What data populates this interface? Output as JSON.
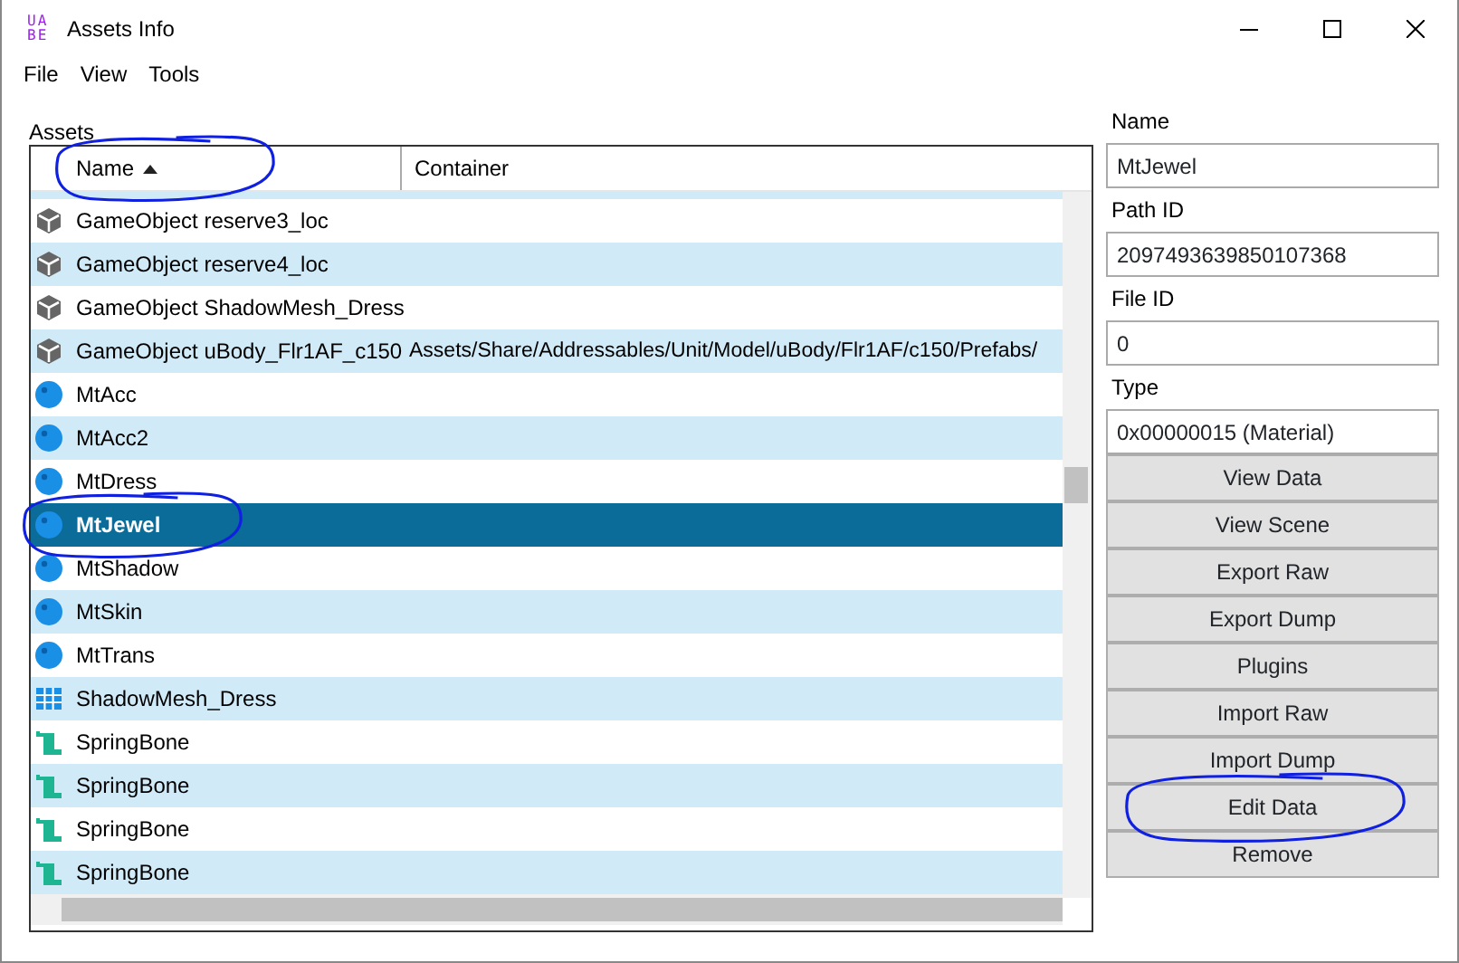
{
  "window": {
    "logo": [
      "UA",
      "BE"
    ],
    "title": "Assets Info"
  },
  "menu": [
    "File",
    "View",
    "Tools"
  ],
  "assets_label": "Assets",
  "columns": [
    {
      "label": "Name",
      "sorted": true,
      "circled": true
    },
    {
      "label": "Container",
      "sorted": false,
      "circled": false
    }
  ],
  "rows": [
    {
      "kind": "gameobject",
      "name": "GameObject reserve3_loc",
      "container": "",
      "selected": false,
      "circled": false
    },
    {
      "kind": "gameobject",
      "name": "GameObject reserve4_loc",
      "container": "",
      "selected": false,
      "circled": false
    },
    {
      "kind": "gameobject",
      "name": "GameObject ShadowMesh_Dress",
      "container": "",
      "selected": false,
      "circled": false
    },
    {
      "kind": "gameobject",
      "name": "GameObject uBody_Flr1AF_c150",
      "container": "Assets/Share/Addressables/Unit/Model/uBody/Flr1AF/c150/Prefabs/",
      "selected": false,
      "circled": false
    },
    {
      "kind": "material",
      "name": "MtAcc",
      "container": "",
      "selected": false,
      "circled": false
    },
    {
      "kind": "material",
      "name": "MtAcc2",
      "container": "",
      "selected": false,
      "circled": false
    },
    {
      "kind": "material",
      "name": "MtDress",
      "container": "",
      "selected": false,
      "circled": false
    },
    {
      "kind": "material",
      "name": "MtJewel",
      "container": "",
      "selected": true,
      "circled": true
    },
    {
      "kind": "material",
      "name": "MtShadow",
      "container": "",
      "selected": false,
      "circled": false
    },
    {
      "kind": "material",
      "name": "MtSkin",
      "container": "",
      "selected": false,
      "circled": false
    },
    {
      "kind": "material",
      "name": "MtTrans",
      "container": "",
      "selected": false,
      "circled": false
    },
    {
      "kind": "mesh",
      "name": "ShadowMesh_Dress",
      "container": "",
      "selected": false,
      "circled": false
    },
    {
      "kind": "script",
      "name": "SpringBone",
      "container": "",
      "selected": false,
      "circled": false
    },
    {
      "kind": "script",
      "name": "SpringBone",
      "container": "",
      "selected": false,
      "circled": false
    },
    {
      "kind": "script",
      "name": "SpringBone",
      "container": "",
      "selected": false,
      "circled": false
    },
    {
      "kind": "script",
      "name": "SpringBone",
      "container": "",
      "selected": false,
      "circled": false
    }
  ],
  "fields": [
    {
      "label": "Name",
      "value": "MtJewel"
    },
    {
      "label": "Path ID",
      "value": "2097493639850107368"
    },
    {
      "label": "File ID",
      "value": "0"
    },
    {
      "label": "Type",
      "value": "0x00000015 (Material)"
    }
  ],
  "buttons": [
    {
      "label": "View Data",
      "circled": false
    },
    {
      "label": "View Scene",
      "circled": false
    },
    {
      "label": "Export Raw",
      "circled": false
    },
    {
      "label": "Export Dump",
      "circled": false
    },
    {
      "label": "Plugins",
      "circled": false
    },
    {
      "label": "Import Raw",
      "circled": false
    },
    {
      "label": "Import Dump",
      "circled": false
    },
    {
      "label": "Edit Data",
      "circled": true
    },
    {
      "label": "Remove",
      "circled": false
    }
  ]
}
